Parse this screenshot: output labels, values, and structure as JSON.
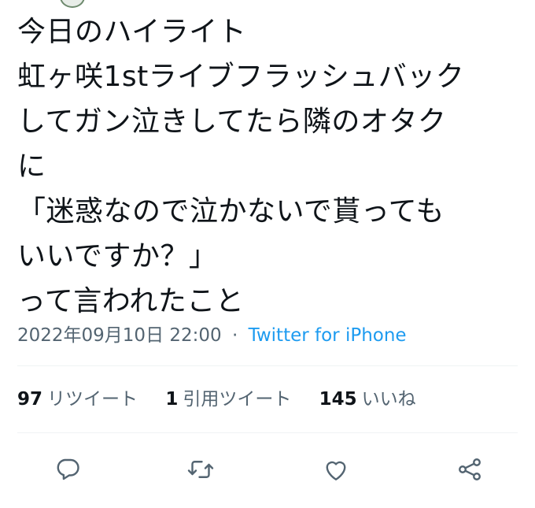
{
  "tweet": {
    "lines": [
      "今日のハイライト",
      "虹ヶ咲1stライブフラッシュバック",
      "してガン泣きしてたら隣のオタク",
      "に",
      "「迷惑なので泣かないで貰っても",
      "いいですか？」",
      "って言われたこと"
    ]
  },
  "meta": {
    "timestamp": "2022年09月10日 22:00",
    "separator": "·",
    "source": "Twitter for iPhone"
  },
  "stats": {
    "retweets": {
      "count": "97",
      "label": "リツイート"
    },
    "quotes": {
      "count": "1",
      "label": "引用ツイート"
    },
    "likes": {
      "count": "145",
      "label": "いいね"
    }
  },
  "actions": {
    "icons": [
      "reply-icon",
      "retweet-icon",
      "like-icon",
      "share-icon"
    ]
  },
  "colors": {
    "text": "#0f1419",
    "secondary": "#536471",
    "link": "#1d9bf0",
    "divider": "#eff3f4"
  }
}
